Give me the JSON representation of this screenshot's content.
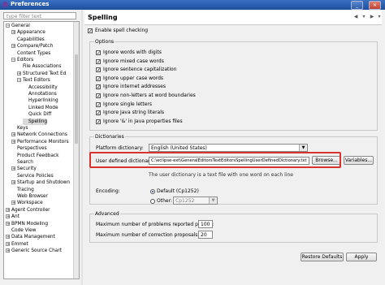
{
  "window": {
    "title": "Preferences"
  },
  "filter": {
    "placeholder": "type filter text"
  },
  "tree": [
    {
      "label": "General",
      "level": 0,
      "exp": "−"
    },
    {
      "label": "Appearance",
      "level": 1,
      "exp": "+"
    },
    {
      "label": "Capabilities",
      "level": 1,
      "exp": ""
    },
    {
      "label": "Compare/Patch",
      "level": 1,
      "exp": "+"
    },
    {
      "label": "Content Types",
      "level": 1,
      "exp": ""
    },
    {
      "label": "Editors",
      "level": 1,
      "exp": "−"
    },
    {
      "label": "File Associations",
      "level": 2,
      "exp": ""
    },
    {
      "label": "Structured Text Ed",
      "level": 2,
      "exp": "+"
    },
    {
      "label": "Text Editors",
      "level": 2,
      "exp": "−"
    },
    {
      "label": "Accessibility",
      "level": 3,
      "exp": ""
    },
    {
      "label": "Annotations",
      "level": 3,
      "exp": ""
    },
    {
      "label": "Hyperlinking",
      "level": 3,
      "exp": ""
    },
    {
      "label": "Linked Mode",
      "level": 3,
      "exp": ""
    },
    {
      "label": "Quick Diff",
      "level": 3,
      "exp": ""
    },
    {
      "label": "Spelling",
      "level": 3,
      "exp": "",
      "selected": true
    },
    {
      "label": "Keys",
      "level": 1,
      "exp": ""
    },
    {
      "label": "Network Connections",
      "level": 1,
      "exp": "+"
    },
    {
      "label": "Performance Monitors",
      "level": 1,
      "exp": "+"
    },
    {
      "label": "Perspectives",
      "level": 1,
      "exp": ""
    },
    {
      "label": "Product Feedback",
      "level": 1,
      "exp": ""
    },
    {
      "label": "Search",
      "level": 1,
      "exp": ""
    },
    {
      "label": "Security",
      "level": 1,
      "exp": "+"
    },
    {
      "label": "Service Policies",
      "level": 1,
      "exp": ""
    },
    {
      "label": "Startup and Shutdown",
      "level": 1,
      "exp": "+"
    },
    {
      "label": "Tracing",
      "level": 1,
      "exp": ""
    },
    {
      "label": "Web Browser",
      "level": 1,
      "exp": ""
    },
    {
      "label": "Workspace",
      "level": 1,
      "exp": "+"
    },
    {
      "label": "Agent Controller",
      "level": 0,
      "exp": "+"
    },
    {
      "label": "Ant",
      "level": 0,
      "exp": "+"
    },
    {
      "label": "BPMN Modeling",
      "level": 0,
      "exp": "+"
    },
    {
      "label": "Code View",
      "level": 0,
      "exp": ""
    },
    {
      "label": "Data Management",
      "level": 0,
      "exp": "+"
    },
    {
      "label": "Emmet",
      "level": 0,
      "exp": "+"
    },
    {
      "label": "Generic Source Chart",
      "level": 0,
      "exp": "+"
    }
  ],
  "page": {
    "title": "Spelling",
    "enable_label": "Enable spell checking",
    "options_title": "Options",
    "options": [
      "Ignore words with digits",
      "Ignore mixed case words",
      "Ignore sentence capitalization",
      "Ignore upper case words",
      "Ignore internet addresses",
      "Ignore non-letters at word boundaries",
      "Ignore single letters",
      "Ignore Java string literals",
      "Ignore '&' in Java properties files"
    ],
    "dict_title": "Dictionaries",
    "platform_label": "Platform dictionary:",
    "platform_value": "English (United States)",
    "user_label": "User defined dictionary:",
    "user_value": "C:\\eclipse-ext\\GeneralEditorsTextEditorsSpellingUserDefinedDictionary.txt",
    "browse_label": "Browse...",
    "variables_label": "Variables...",
    "user_hint": "The user dictionary is a text file with one word on each line",
    "encoding_label": "Encoding:",
    "default_label": "Default (Cp1252)",
    "other_label": "Other:",
    "other_value": "Cp1252",
    "advanced_title": "Advanced",
    "max_problems_label": "Maximum number of problems reported per file:",
    "max_problems_value": "100",
    "max_proposals_label": "Maximum number of correction proposals:",
    "max_proposals_value": "20",
    "restore_label": "Restore Defaults",
    "apply_label": "Apply"
  }
}
